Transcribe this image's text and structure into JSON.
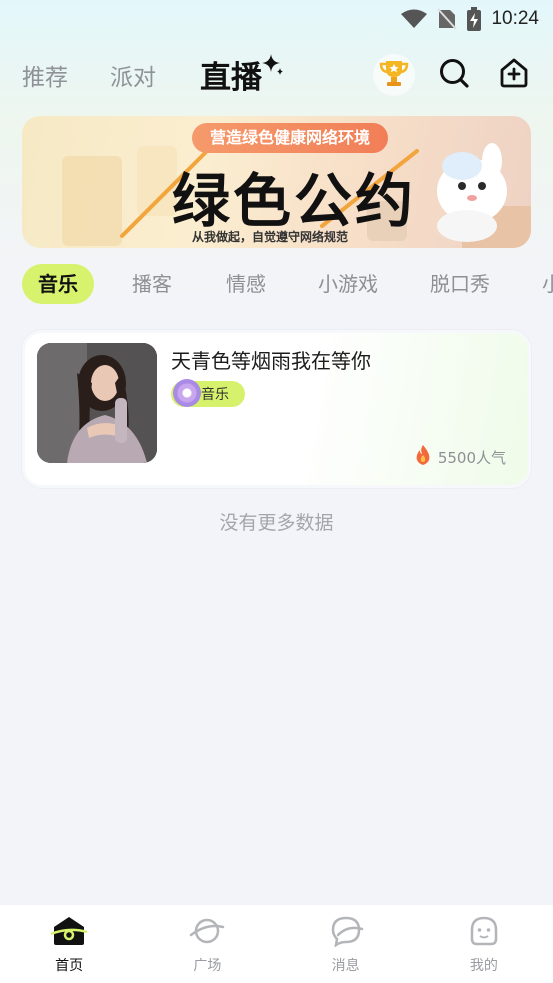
{
  "status_bar": {
    "time": "10:24"
  },
  "top_nav": {
    "tabs": [
      {
        "label": "推荐"
      },
      {
        "label": "派对"
      },
      {
        "label": "直播"
      }
    ],
    "active_tab": "直播"
  },
  "banner": {
    "pill_text": "营造绿色健康网络环境",
    "title": "绿色公约",
    "subtitle": "从我做起，自觉遵守网络规范"
  },
  "categories": [
    {
      "label": "音乐"
    },
    {
      "label": "播客"
    },
    {
      "label": "情感"
    },
    {
      "label": "小游戏"
    },
    {
      "label": "脱口秀"
    },
    {
      "label": "小"
    }
  ],
  "live_card": {
    "title": "天青色等烟雨我在等你",
    "tag": "音乐",
    "popularity": "5500人气"
  },
  "list_end_text": "没有更多数据",
  "bottom_nav": [
    {
      "label": "首页",
      "icon": "home-icon"
    },
    {
      "label": "广场",
      "icon": "planet-icon"
    },
    {
      "label": "消息",
      "icon": "message-icon"
    },
    {
      "label": "我的",
      "icon": "profile-icon"
    }
  ],
  "colors": {
    "accent": "#d7f26d",
    "text_primary": "#111111",
    "text_secondary": "#8e9095",
    "banner_pill": "#f27e57"
  }
}
